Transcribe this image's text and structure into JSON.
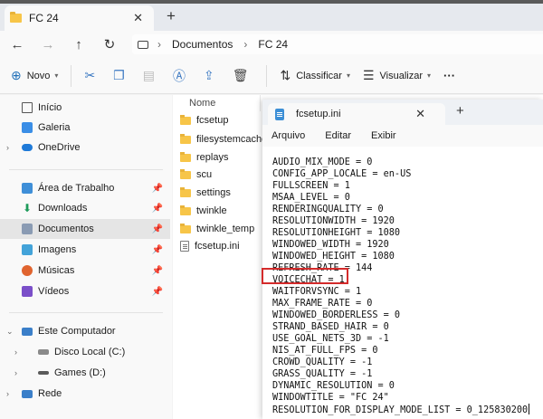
{
  "explorer": {
    "tab_title": "FC 24",
    "breadcrumb": [
      "Documentos",
      "FC 24"
    ],
    "toolbar": {
      "new_label": "Novo",
      "sort_label": "Classificar",
      "view_label": "Visualizar",
      "more_label": "···"
    },
    "column_name": "Nome",
    "sidebar": {
      "home": "Início",
      "gallery": "Galeria",
      "onedrive": "OneDrive",
      "desktop": "Área de Trabalho",
      "downloads": "Downloads",
      "documents": "Documentos",
      "pictures": "Imagens",
      "music": "Músicas",
      "videos": "Vídeos",
      "this_pc": "Este Computador",
      "disk_c": "Disco Local (C:)",
      "disk_d": "Games (D:)",
      "network": "Rede"
    },
    "files": [
      "fcsetup",
      "filesystemcache",
      "replays",
      "scu",
      "settings",
      "twinkle",
      "twinkle_temp",
      "fcsetup.ini"
    ]
  },
  "notepad": {
    "tab_title": "fcsetup.ini",
    "menu": {
      "file": "Arquivo",
      "edit": "Editar",
      "view": "Exibir"
    },
    "lines": [
      "AUDIO_MIX_MODE = 0",
      "CONFIG_APP_LOCALE = en-US",
      "FULLSCREEN = 1",
      "MSAA_LEVEL = 0",
      "RENDERINGQUALITY = 0",
      "RESOLUTIONWIDTH = 1920",
      "RESOLUTIONHEIGHT = 1080",
      "WINDOWED_WIDTH = 1920",
      "WINDOWED_HEIGHT = 1080",
      "REFRESH_RATE = 144",
      "VOICECHAT = 1",
      "WAITFORVSYNC = 1",
      "MAX_FRAME_RATE = 0",
      "WINDOWED_BORDERLESS = 0",
      "STRAND_BASED_HAIR = 0",
      "USE_GOAL_NETS_3D = -1",
      "NIS_AT_FULL_FPS = 0",
      "CROWD_QUALITY = -1",
      "GRASS_QUALITY = -1",
      "DYNAMIC_RESOLUTION = 0",
      "WINDOWTITLE = \"FC 24\"",
      "RESOLUTION_FOR_DISPLAY_MODE_LIST = 0_125830200"
    ],
    "highlight_color": "#d42b2b"
  }
}
